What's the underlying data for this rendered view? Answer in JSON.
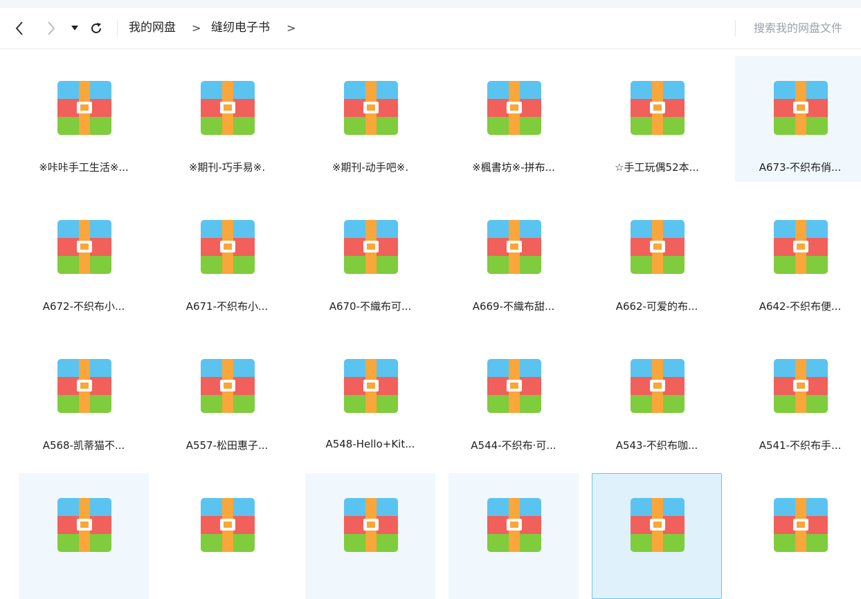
{
  "toolbar": {
    "back_icon": "chevron-left-icon",
    "forward_icon": "chevron-right-icon",
    "history_icon": "caret-down-icon",
    "refresh_icon": "refresh-icon",
    "breadcrumb": [
      "我的网盘",
      "缝纫电子书"
    ],
    "separator": ">",
    "search_placeholder": "搜索我的网盘文件"
  },
  "file_icon": "archive-icon",
  "colors": {
    "icon_blue": "#5bc3f0",
    "icon_red": "#f1605b",
    "icon_green": "#7fcc3d",
    "icon_orange": "#f9a63a",
    "selection_border": "#66c5ea",
    "selection_bg": "#dff1fb",
    "hover_bg": "#f1f8fd"
  },
  "files": [
    {
      "name": "※咔咔手工生活※..."
    },
    {
      "name": "※期刊-巧手易※."
    },
    {
      "name": "※期刊-动手吧※."
    },
    {
      "name": "※楓書坊※-拼布..."
    },
    {
      "name": "☆手工玩偶52本..."
    },
    {
      "name": "A673-不织布俏...",
      "state": "hover"
    },
    {
      "name": "A672-不织布小..."
    },
    {
      "name": "A671-不织布小..."
    },
    {
      "name": "A670-不織布可..."
    },
    {
      "name": "A669-不織布甜..."
    },
    {
      "name": "A662-可爱的布..."
    },
    {
      "name": "A642-不织布便..."
    },
    {
      "name": "A568-凯蒂猫不..."
    },
    {
      "name": "A557-松田惠子..."
    },
    {
      "name": "A548-Hello+Kit..."
    },
    {
      "name": "A544-不织布·可..."
    },
    {
      "name": "A543-不织布咖..."
    },
    {
      "name": "A541-不织布手..."
    },
    {
      "name": "",
      "state": "hover"
    },
    {
      "name": ""
    },
    {
      "name": "",
      "state": "hover"
    },
    {
      "name": "",
      "state": "hover"
    },
    {
      "name": "",
      "state": "selected"
    },
    {
      "name": ""
    }
  ]
}
